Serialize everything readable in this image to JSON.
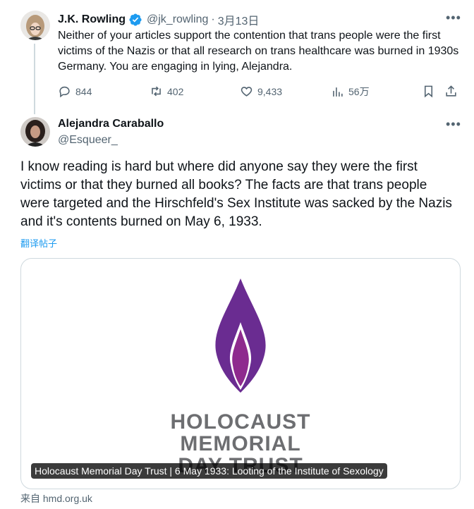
{
  "tweet1": {
    "name": "J.K. Rowling",
    "handle": "@jk_rowling",
    "separator": "·",
    "date": "3月13日",
    "text": "Neither of your articles support the contention that trans people were the first victims of the Nazis or that all research on trans healthcare was burned in 1930s Germany. You are engaging in lying, Alejandra.",
    "replies": "844",
    "retweets": "402",
    "likes": "9,433",
    "views": "56万"
  },
  "tweet2": {
    "name": "Alejandra Caraballo",
    "handle": "@Esqueer_",
    "text": "I know reading is hard but where did anyone say they were the first victims or that they burned all books? The facts are that trans people were targeted and the Hirschfeld's Sex Institute was sacked by the Nazis and it's contents burned on May 6, 1933.",
    "translate_label": "翻译帖子",
    "card": {
      "logo_line1": "HOLOCAUST",
      "logo_line2": "MEMORIAL",
      "logo_line3": "DAY TRUST",
      "caption": "Holocaust Memorial Day Trust | 6 May 1933: Looting of the Institute of Sexology"
    },
    "source_label": "来自 hmd.org.uk"
  },
  "icons": {
    "more": "more-icon",
    "reply": "reply-icon",
    "retweet": "retweet-icon",
    "like": "like-icon",
    "views": "views-icon",
    "bookmark": "bookmark-icon",
    "share": "share-icon",
    "verified": "verified-badge-icon"
  },
  "colors": {
    "accent": "#1d9bf0",
    "muted": "#536471",
    "flame_outer": "#6a2c91",
    "flame_inner": "#8e2a8e",
    "logo_text": "#6d6e71"
  }
}
